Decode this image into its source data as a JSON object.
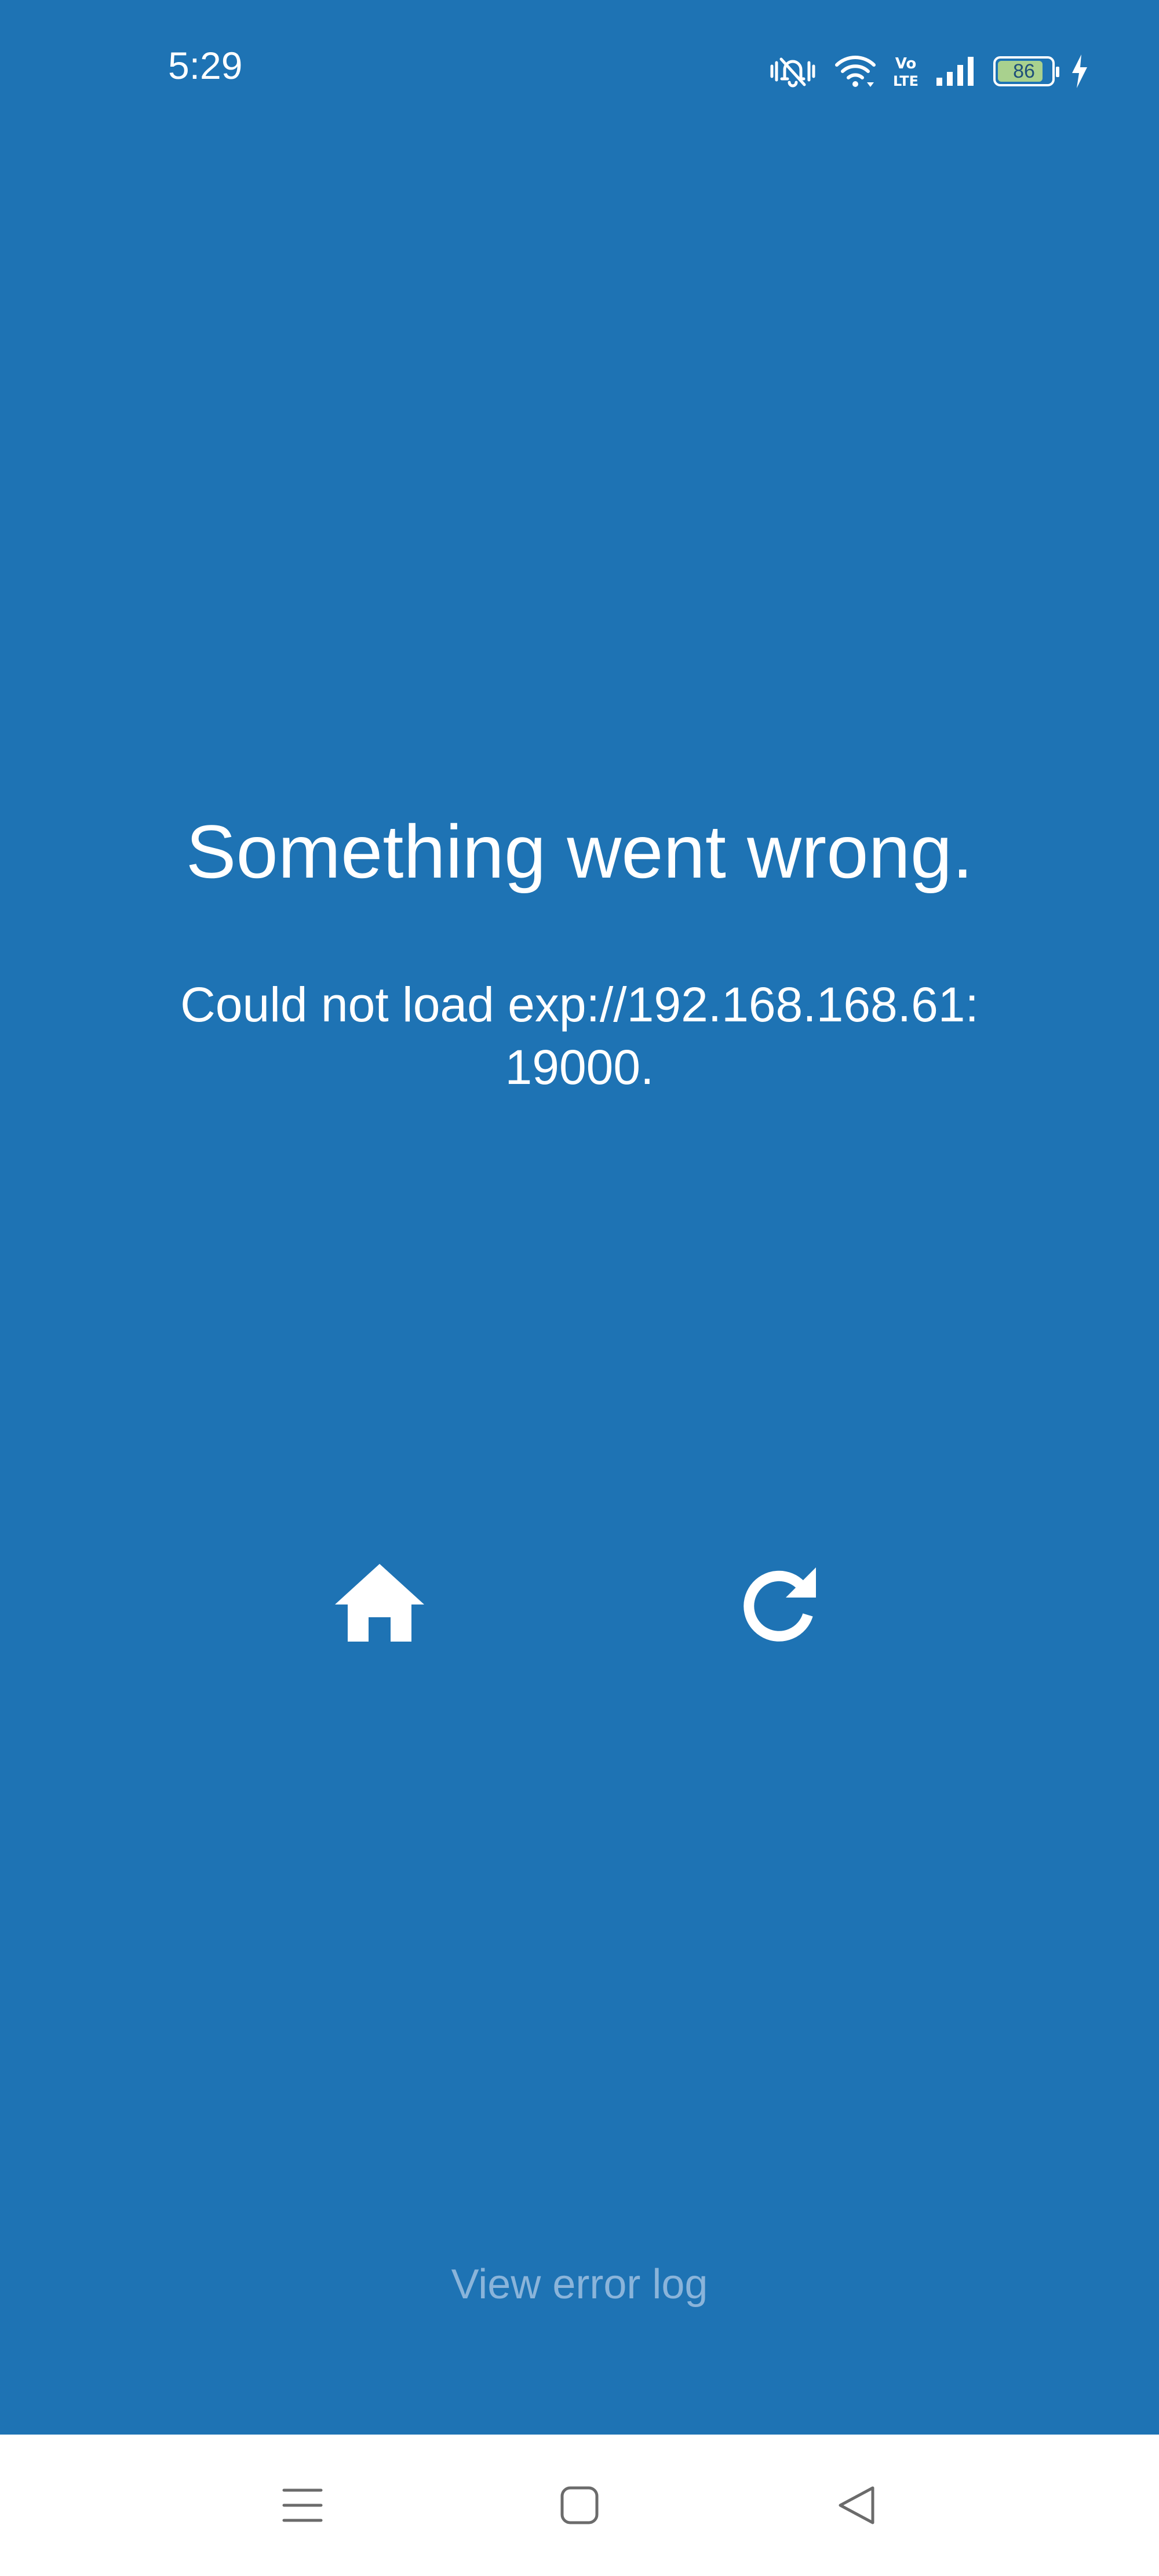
{
  "status_bar": {
    "time": "5:29",
    "battery_level": "86",
    "battery_fraction": 0.86,
    "icons": [
      "mute-vibrate-icon",
      "wifi-icon",
      "volte-icon",
      "signal-icon",
      "battery-icon",
      "charging-icon"
    ]
  },
  "error": {
    "title": "Something went wrong.",
    "message": "Could not load exp://192.168.168.61:19000."
  },
  "actions": {
    "home_icon": "home-icon",
    "reload_icon": "reload-icon",
    "view_log_label": "View error log"
  },
  "nav_bar": {
    "menu_icon": "menu-icon",
    "home_icon": "square-home-icon",
    "back_icon": "back-triangle-icon"
  },
  "colors": {
    "background": "#1E73B4",
    "text": "#FFFFFF",
    "link": "#8AB4DA",
    "nav_background": "#FFFFFF",
    "nav_icon": "#6B6B6B"
  }
}
